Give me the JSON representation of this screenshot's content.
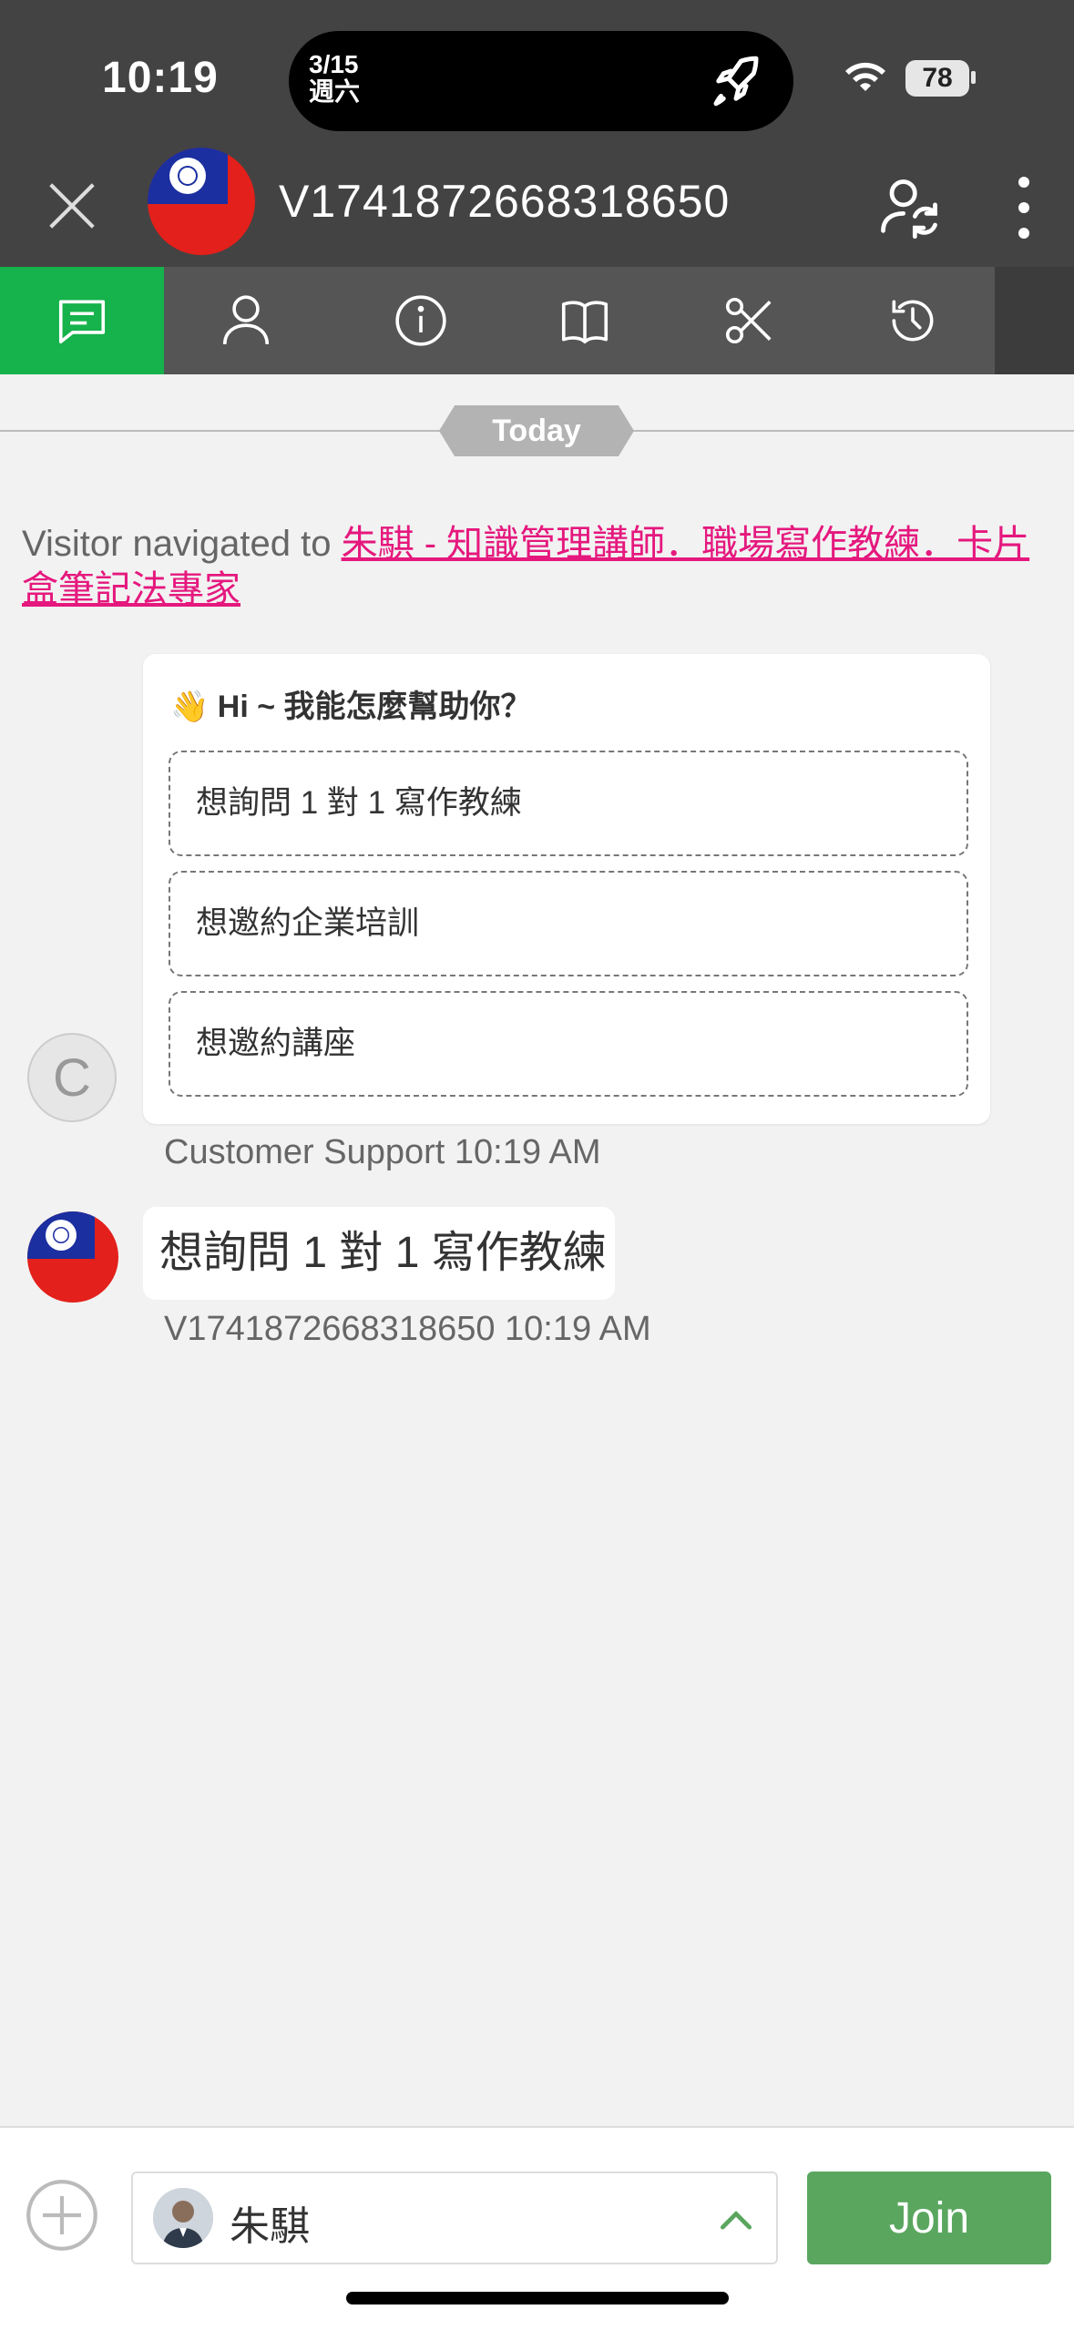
{
  "status_bar": {
    "time": "10:19",
    "island_date_line1": "3/15",
    "island_date_line2": "週六",
    "battery": "78",
    "icons": [
      "rocket-icon",
      "wifi-icon",
      "battery-icon"
    ]
  },
  "header": {
    "title": "V1741872668318650",
    "icons": [
      "close-icon",
      "taiwan-flag-avatar",
      "transfer-visitor-icon",
      "more-vertical-icon"
    ]
  },
  "tabs": [
    {
      "name": "chat",
      "icon": "chat-icon",
      "active": true
    },
    {
      "name": "visitor",
      "icon": "user-icon",
      "active": false
    },
    {
      "name": "info",
      "icon": "info-icon",
      "active": false
    },
    {
      "name": "canned",
      "icon": "book-icon",
      "active": false
    },
    {
      "name": "shortcuts",
      "icon": "scissors-icon",
      "active": false
    },
    {
      "name": "history",
      "icon": "history-icon",
      "active": false
    }
  ],
  "chat": {
    "day_label": "Today",
    "navigation_prefix": "Visitor navigated to ",
    "navigation_link": "朱騏 - 知識管理講師．職場寫作教練．卡片盒筆記法專家",
    "bot_card": {
      "title": "👋 Hi ~ 我能怎麼幫助你？",
      "options": [
        "想詢問 1 對 1 寫作教練",
        "想邀約企業培訓",
        "想邀約講座"
      ]
    },
    "support_avatar_letter": "C",
    "support_meta": "Customer Support 10:19 AM",
    "user_message": "想詢問 1 對 1 寫作教練",
    "user_meta": "V1741872668318650 10:19 AM"
  },
  "composer": {
    "agent_name": "朱騏",
    "join_label": "Join"
  },
  "colors": {
    "header_bg": "#434343",
    "tab_active": "#16b24b",
    "link": "#e5187e",
    "join_button": "#5aa65f"
  }
}
